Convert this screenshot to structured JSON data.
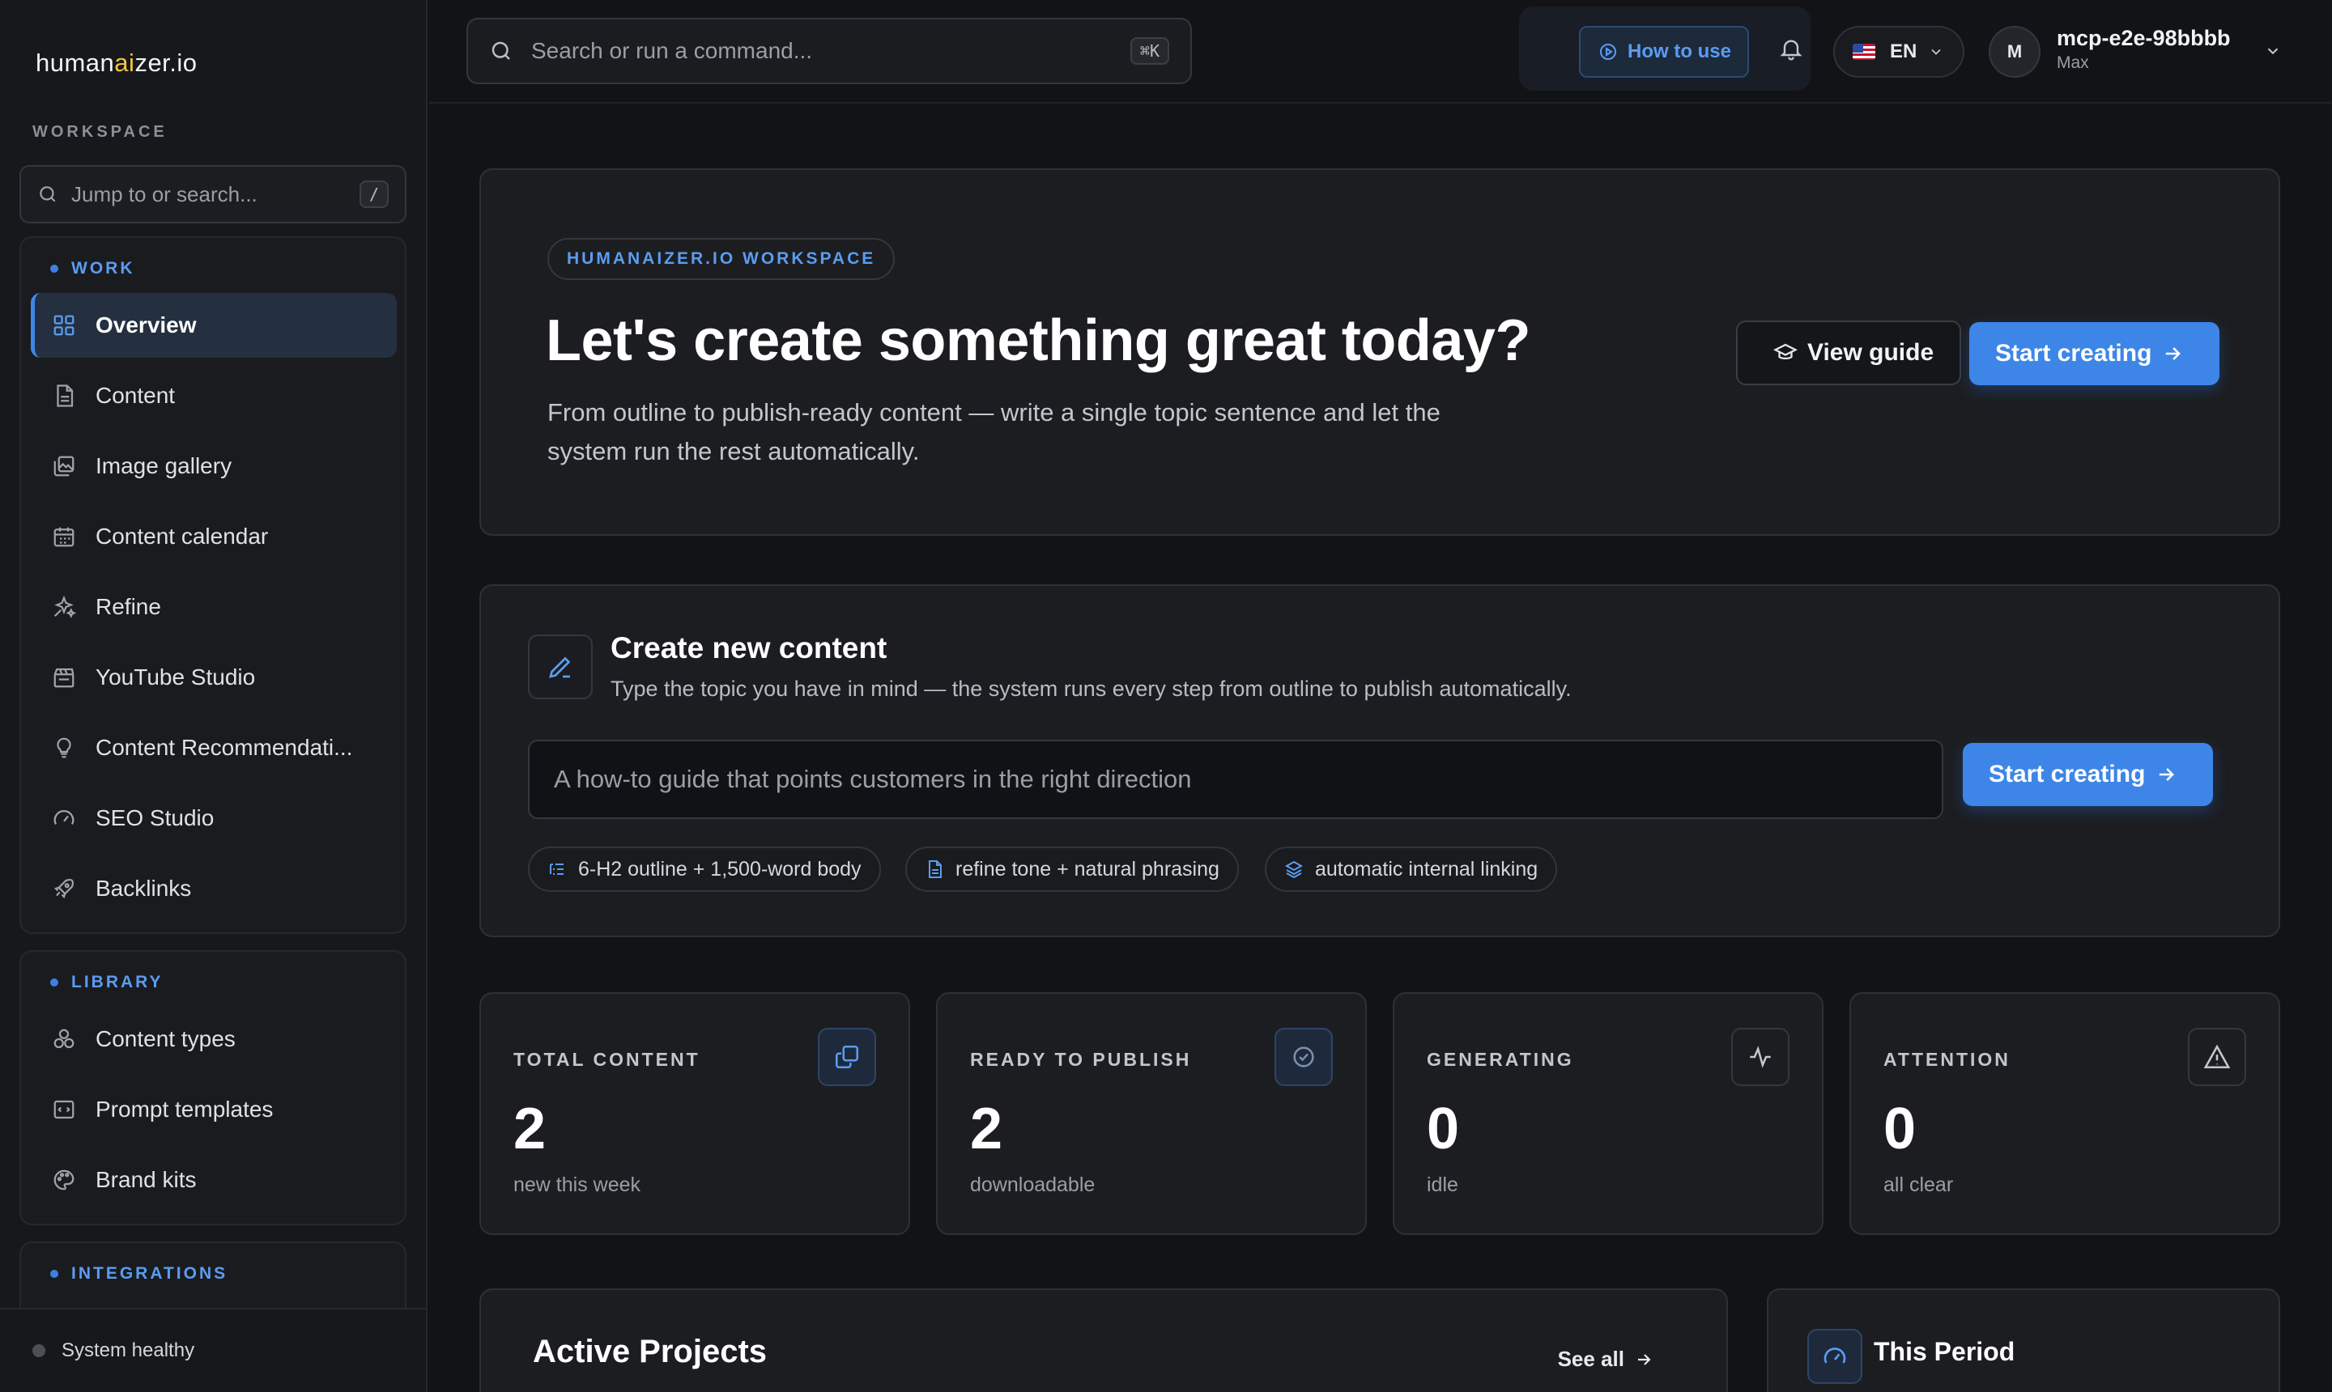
{
  "brand": {
    "logo_pre": "human",
    "logo_ai": "ai",
    "logo_post": "zer.io",
    "accent": "#3d86e8"
  },
  "sidebar": {
    "workspace_label": "WORKSPACE",
    "search_placeholder": "Jump to or search...",
    "search_shortcut": "/",
    "groups": [
      {
        "title": "WORK",
        "items": [
          {
            "label": "Overview",
            "icon": "grid-icon",
            "active": true
          },
          {
            "label": "Content",
            "icon": "document-icon"
          },
          {
            "label": "Image gallery",
            "icon": "images-icon"
          },
          {
            "label": "Content calendar",
            "icon": "calendar-icon"
          },
          {
            "label": "Refine",
            "icon": "sparkles-icon"
          },
          {
            "label": "YouTube Studio",
            "icon": "clapperboard-icon"
          },
          {
            "label": "Content Recommendati...",
            "icon": "lightbulb-icon"
          },
          {
            "label": "SEO Studio",
            "icon": "gauge-icon"
          },
          {
            "label": "Backlinks",
            "icon": "rocket-icon"
          }
        ]
      },
      {
        "title": "LIBRARY",
        "items": [
          {
            "label": "Content types",
            "icon": "shapes-icon"
          },
          {
            "label": "Prompt templates",
            "icon": "code-template-icon"
          },
          {
            "label": "Brand kits",
            "icon": "palette-icon"
          }
        ]
      },
      {
        "title": "INTEGRATIONS",
        "items": []
      }
    ],
    "status": "System healthy"
  },
  "topbar": {
    "search_placeholder": "Search or run a command...",
    "search_shortcut": "⌘K",
    "how_to_use": "How to use",
    "language": "EN",
    "avatar_initial": "M",
    "user_name": "mcp-e2e-98bbbb",
    "user_sub": "Max"
  },
  "hero": {
    "tag": "HUMANAIZER.IO WORKSPACE",
    "title": "Let's create something great today?",
    "description": "From outline to publish-ready content — write a single topic sentence and let the system run the rest automatically.",
    "view_guide": "View guide",
    "start_creating": "Start creating"
  },
  "create": {
    "title": "Create new content",
    "description": "Type the topic you have in mind — the system runs every step from outline to publish automatically.",
    "input_placeholder": "A how-to guide that points customers in the right direction",
    "start_creating": "Start creating",
    "chips": [
      {
        "label": "6-H2 outline + 1,500-word body",
        "icon": "list-outline-icon"
      },
      {
        "label": "refine tone + natural phrasing",
        "icon": "document-icon"
      },
      {
        "label": "automatic internal linking",
        "icon": "layers-icon"
      }
    ]
  },
  "stats": [
    {
      "label": "TOTAL CONTENT",
      "value": "2",
      "sub": "new this week",
      "icon": "copy-icon"
    },
    {
      "label": "READY TO PUBLISH",
      "value": "2",
      "sub": "downloadable",
      "icon": "check-badge-icon"
    },
    {
      "label": "GENERATING",
      "value": "0",
      "sub": "idle",
      "icon": "activity-icon"
    },
    {
      "label": "ATTENTION",
      "value": "0",
      "sub": "all clear",
      "icon": "warning-icon"
    }
  ],
  "projects": {
    "title": "Active Projects",
    "see_all": "See all"
  },
  "period": {
    "title": "This Period"
  }
}
